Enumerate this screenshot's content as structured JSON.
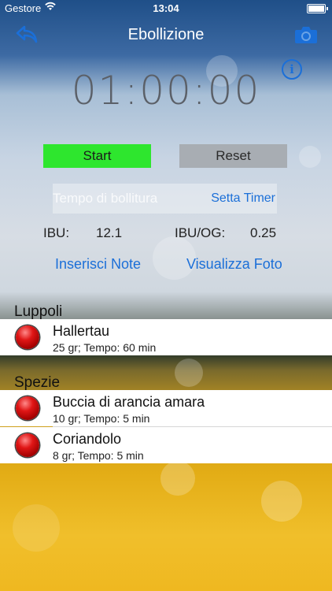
{
  "status_bar": {
    "carrier": "Gestore",
    "time": "13:04"
  },
  "nav": {
    "title": "Ebollizione",
    "back_icon": "back-arrow-icon",
    "camera_icon": "camera-icon"
  },
  "info_icon": "info-icon",
  "timer": {
    "display": "01:00:00",
    "start_label": "Start",
    "reset_label": "Reset",
    "start_color": "#2ee62e",
    "reset_color": "#a8adb3"
  },
  "boil_time": {
    "placeholder": "Tempo di bollitura",
    "value": "",
    "set_timer_label": "Setta Timer"
  },
  "stats": {
    "ibu_label": "IBU:",
    "ibu_value": "12.1",
    "ibu_og_label": "IBU/OG:",
    "ibu_og_value": "0.25"
  },
  "links": {
    "notes_label": "Inserisci Note",
    "photo_label": "Visualizza Foto"
  },
  "accent_color": "#1b6fd8",
  "sections": [
    {
      "title": "Luppoli",
      "items": [
        {
          "name": "Hallertau",
          "detail": "25 gr; Tempo: 60 min"
        }
      ]
    },
    {
      "title": "Spezie",
      "items": [
        {
          "name": "Buccia di arancia amara",
          "detail": "10 gr; Tempo: 5 min"
        },
        {
          "name": "Coriandolo",
          "detail": "8 gr; Tempo: 5 min"
        }
      ]
    }
  ]
}
